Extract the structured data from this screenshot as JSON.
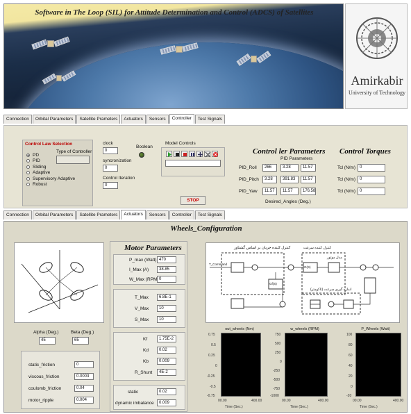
{
  "banner": {
    "title": "Software in The Loop (SIL) for Attitude Determination and Control (ADCS) of Satellites",
    "logo_name": "Amirkabir",
    "logo_sub": "University of Technology"
  },
  "tabs_top": [
    "Connection",
    "Orbital Parameters",
    "Satellite Prameters",
    "Actuators",
    "Sensors",
    "Controller",
    "Test Signals"
  ],
  "tabs_top_active": "Controller",
  "controller": {
    "law_title": "Control Law Selection",
    "type_label": "Type of Controller",
    "laws": [
      "PD",
      "PID",
      "Sliding",
      "Adaptive",
      "Supervisory Adaptive",
      "Robust"
    ],
    "selected_law": "PD",
    "clock_label": "clock",
    "clock_value": "0",
    "boolean_label": "Boolean",
    "sync_label": "syncronization",
    "sync_value": "0",
    "iter_label": "Control Iteration",
    "iter_value": "0",
    "model_controls_label": "Model Controls",
    "stop_label": "STOP",
    "params_title": "Control ler Parameters",
    "pid_title": "PID Parameters",
    "pid_rows": [
      {
        "label": "PID_Roll",
        "values": [
          "266",
          "3.28",
          "11.57"
        ]
      },
      {
        "label": "PID_Pitch",
        "values": [
          "3.28",
          "391.83",
          "11.57"
        ]
      },
      {
        "label": "PID_Yaw",
        "values": [
          "11.57",
          "11.57",
          "176.58"
        ]
      }
    ],
    "desired_label": "Desired_Angles (Deg.)",
    "torques_title": "Control Torques",
    "torques": [
      {
        "label": "Tcl (N/m)",
        "value": "0"
      },
      {
        "label": "Tcl (N/m)",
        "value": "0"
      },
      {
        "label": "Tcl (N/m)",
        "value": "0"
      }
    ]
  },
  "tabs_bottom": [
    "Connection",
    "Orbital Parameters",
    "Satellite Prameters",
    "Actuators",
    "Sensors",
    "Controller",
    "Test Signals"
  ],
  "tabs_bottom_active": "Actuators",
  "actuators": {
    "title": "Wheels_Configuration",
    "alpha_label": "Alpha (Deg.)",
    "alpha_value": "45",
    "beta_label": "Beta (Deg.)",
    "beta_value": "65",
    "friction": [
      {
        "label": "static_friction",
        "value": "0"
      },
      {
        "label": "viscous_friction",
        "value": "0.0003"
      },
      {
        "label": "coulomb_friction",
        "value": "0.04"
      },
      {
        "label": "motor_ripple",
        "value": "0.004"
      }
    ],
    "motor_title": "Motor Parameters",
    "motor_group1": [
      {
        "label": "P_max (Watt)",
        "value": "470"
      },
      {
        "label": "I_Max (A)",
        "value": "38.85"
      },
      {
        "label": "W_Max (RPM)",
        "value": "0"
      }
    ],
    "motor_group2": [
      {
        "label": "T_Max",
        "value": "6.8E-1"
      },
      {
        "label": "V_Max",
        "value": "10"
      },
      {
        "label": "S_Max",
        "value": "10"
      }
    ],
    "motor_group3": [
      {
        "label": "Kf",
        "value": "1.75E-2"
      },
      {
        "label": "Kd",
        "value": "0.02"
      },
      {
        "label": "Kb",
        "value": "0.009"
      },
      {
        "label": "R_Shunt",
        "value": "4E-2"
      }
    ],
    "motor_group4": [
      {
        "label": "static",
        "value": "0.02"
      },
      {
        "label": "dynamic imbalance",
        "value": "0.009"
      }
    ],
    "diagram_labels": {
      "arabic_top": "کنترل کننده جریان بر اساس گشتاور",
      "arabic_mid1": "کنترل کننده سرعت",
      "arabic_mid2": "مدل موتور",
      "arabic_bottom": "اندازه گیری سرعت (تاکومتر)",
      "tcommand": "T_Command",
      "g_s": "G(S)",
      "gf_s": "Gf(S)"
    },
    "charts": [
      {
        "title": "out_wheels (Nm)",
        "yticks": [
          "0.75",
          "0.5",
          "0.25",
          "0",
          "-0.25",
          "-0.5",
          "-0.75"
        ],
        "xticks": [
          "00.00",
          "400.00"
        ],
        "xlabel": "Time (Sec.)",
        "ylabel": "Amplitude"
      },
      {
        "title": "w_wheels (RPM)",
        "yticks": [
          "750",
          "500",
          "250",
          "0",
          "-250",
          "-500",
          "-750",
          "-1000"
        ],
        "xticks": [
          "00.00",
          "400.00"
        ],
        "xlabel": "Time (Sec.)",
        "ylabel": "Amplitude"
      },
      {
        "title": "P_Wheels (Watt)",
        "yticks": [
          "100",
          "80",
          "60",
          "40",
          "20",
          "0",
          "-20"
        ],
        "xticks": [
          "00.00",
          "400.00"
        ],
        "xlabel": "Time (Sec.)",
        "ylabel": "Amplitude"
      }
    ]
  }
}
